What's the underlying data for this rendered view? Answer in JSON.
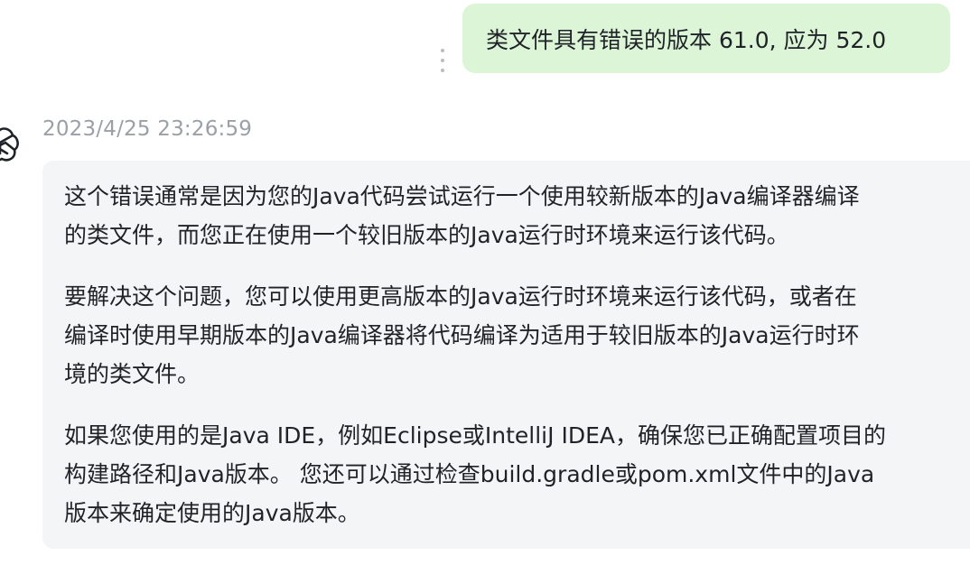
{
  "user_message": {
    "text": "类文件具有错误的版本 61.0, 应为 52.0"
  },
  "assistant_message": {
    "timestamp": "2023/4/25 23:26:59",
    "paragraphs": [
      "这个错误通常是因为您的Java代码尝试运行一个使用较新版本的Java编译器编译\n的类文件，而您正在使用一个较旧版本的Java运行时环境来运行该代码。",
      "要解决这个问题，您可以使用更高版本的Java运行时环境来运行该代码，或者在\n编译时使用早期版本的Java编译器将代码编译为适用于较旧版本的Java运行时环\n境的类文件。",
      "如果您使用的是Java IDE，例如Eclipse或IntelliJ IDEA，确保您已正确配置项目的\n构建路径和Java版本。 您还可以通过检查build.gradle或pom.xml文件中的Java\n版本来确定使用的Java版本。"
    ]
  },
  "icons": {
    "more": "vertical-ellipsis-icon",
    "avatar": "openai-logo-icon"
  },
  "colors": {
    "user_bubble": "#dcf5d6",
    "assistant_bubble": "#f4f5f7",
    "timestamp": "#9aa0a6"
  }
}
